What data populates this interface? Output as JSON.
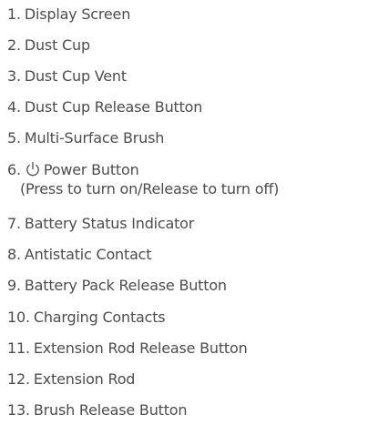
{
  "items": [
    {
      "num": "1.",
      "label": "Display Screen"
    },
    {
      "num": "2.",
      "label": "Dust Cup"
    },
    {
      "num": "3.",
      "label": "Dust Cup Vent"
    },
    {
      "num": "4.",
      "label": "Dust Cup Release Button"
    },
    {
      "num": "5.",
      "label": "Multi-Surface Brush"
    },
    {
      "num": "6.",
      "label": "Power Button",
      "icon": "power-icon",
      "note": "(Press to turn on/Release to turn off)"
    },
    {
      "num": "7.",
      "label": "Battery Status Indicator"
    },
    {
      "num": "8.",
      "label": "Antistatic Contact"
    },
    {
      "num": "9.",
      "label": "Battery Pack Release Button"
    },
    {
      "num": "10.",
      "label": "Charging Contacts"
    },
    {
      "num": "11.",
      "label": "Extension Rod Release Button"
    },
    {
      "num": "12.",
      "label": "Extension Rod"
    },
    {
      "num": "13.",
      "label": "Brush Release Button"
    }
  ],
  "colors": {
    "text": "#4d4d4d",
    "background": "#ffffff"
  }
}
